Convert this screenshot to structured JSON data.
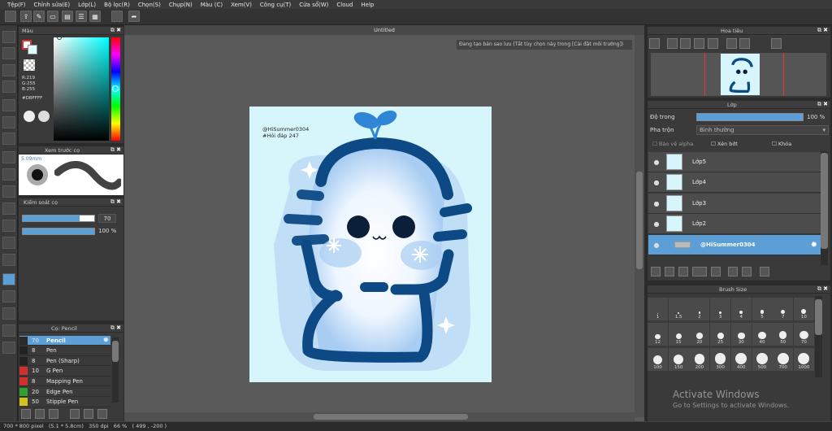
{
  "menu": [
    "Tệp(F)",
    "Chỉnh sửa(E)",
    "Lớp(L)",
    "Bộ lọc(R)",
    "Chọn(S)",
    "Chụp(N)",
    "Màu (C)",
    "Xem(V)",
    "Công cụ(T)",
    "Cửa sổ(W)",
    "Cloud",
    "Help"
  ],
  "color_panel": {
    "title": "Màu",
    "r": "R:219",
    "g": "G:255",
    "b": "B:255",
    "hex": "#DBFFFF"
  },
  "brush_preview": {
    "title": "Xem trước cọ",
    "size": "5.09mm"
  },
  "brush_control": {
    "title": "Kiểm soát cọ",
    "size_value": "70",
    "opacity_value": "100 %"
  },
  "brush_list": {
    "title": "Cọ: Pencil",
    "items": [
      {
        "size": "70",
        "name": "Pencil",
        "color": "#2a2a2a"
      },
      {
        "size": "8",
        "name": "Pen",
        "color": "#222222"
      },
      {
        "size": "8",
        "name": "Pen (Sharp)",
        "color": "#222222"
      },
      {
        "size": "10",
        "name": "G Pen",
        "color": "#d03030"
      },
      {
        "size": "8",
        "name": "Mapping Pen",
        "color": "#d03030"
      },
      {
        "size": "20",
        "name": "Edge Pen",
        "color": "#30a030"
      },
      {
        "size": "50",
        "name": "Stipple Pen",
        "color": "#d0c020"
      }
    ]
  },
  "canvas": {
    "title": "Untitled",
    "notice": "Đang tạo bản sao lưu (Tắt tùy chọn này trong [Cài đặt môi trường])",
    "watermark_1": "@HiSummer0304",
    "watermark_2": "#Hỏi đáp 247"
  },
  "navigator": {
    "title": "Hoa tiêu"
  },
  "layers_panel": {
    "title": "Lớp",
    "opacity_label": "Độ trong",
    "opacity_value": "100 %",
    "blend_label": "Pha trộn",
    "blend_value": "Bình thường",
    "protect_alpha": "Bảo vệ alpha",
    "clip": "Xén bớt",
    "lock": "Khóa",
    "layers": [
      "Lớp5",
      "Lớp4",
      "Lớp3",
      "Lớp2",
      "@HiSummer0304"
    ]
  },
  "brush_size": {
    "title": "Brush Size",
    "sizes": [
      "1",
      "1.5",
      "2",
      "3",
      "4",
      "5",
      "7",
      "10",
      "12",
      "15",
      "20",
      "25",
      "30",
      "40",
      "50",
      "70",
      "100",
      "150",
      "200",
      "300",
      "400",
      "500",
      "700",
      "1000"
    ]
  },
  "status": "700 * 800 pixel   (5.1 * 5.8cm)   350 dpi   66 %   ( 499 , -200 )",
  "watermark": {
    "line1": "Activate Windows",
    "line2": "Go to Settings to activate Windows."
  },
  "colors": {
    "accent": "#5b9fd6",
    "art_blue": "#0d4a85",
    "canvas_bg": "#d6f6fb"
  }
}
